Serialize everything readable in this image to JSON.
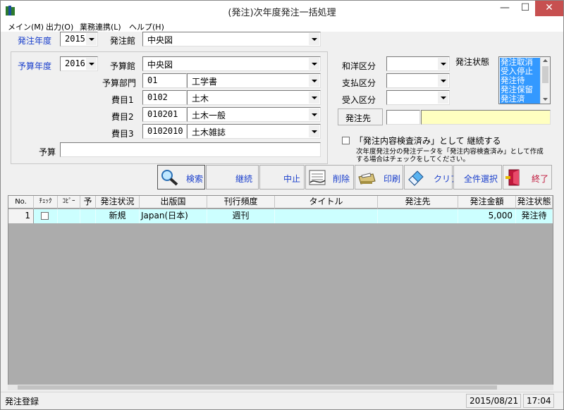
{
  "window": {
    "title": "(発注)次年度発注一括処理",
    "min": "—",
    "max": "☐",
    "close": "✕"
  },
  "menu": [
    "メイン(M)",
    "出力(O)",
    "業務連携(L)",
    "ヘルプ(H)"
  ],
  "top": {
    "order_year_label": "発注年度",
    "order_year": "2015",
    "order_lib_label": "発注館",
    "order_lib": "中央図"
  },
  "budget": {
    "year_label": "予算年度",
    "year": "2016",
    "lib_label": "予算館",
    "lib": "中央図",
    "dept_label": "予算部門",
    "dept_code": "01",
    "dept_name": "工学書",
    "item1_label": "費目1",
    "item1_code": "0102",
    "item1_name": "土木",
    "item2_label": "費目2",
    "item2_code": "010201",
    "item2_name": "土木一般",
    "item3_label": "費目3",
    "item3_code": "0102010",
    "item3_name": "土木雑誌",
    "budget_label": "予算",
    "budget_value": ""
  },
  "right": {
    "wayo_label": "和洋区分",
    "shiharai_label": "支払区分",
    "ukeire_label": "受入区分",
    "status_label": "発注状態",
    "status_options": [
      "発注取消",
      "受入停止",
      "発注待",
      "発注保留",
      "発注済"
    ],
    "vendor_button": "発注先",
    "continue_check": "「発注内容検査済み」として 継続する",
    "note_line1": "次年度発注分の発注データを「発注内容検査済み」として作成",
    "note_line2": "する場合はチェックをしてください。"
  },
  "toolbar": {
    "search": "検索",
    "continue": "継続",
    "stop": "中止",
    "delete": "削除",
    "print": "印刷",
    "clear": "クリア",
    "select_all": "全件選択",
    "exit": "終了"
  },
  "grid": {
    "headers": [
      "No.",
      "ﾁｪｯｸ",
      "ｺﾋﾟｰ",
      "予",
      "発注状況",
      "出版国",
      "刊行頻度",
      "タイトル",
      "発注先",
      "発注金額",
      "発注状態"
    ],
    "rows": [
      {
        "no": "1",
        "status": "新規",
        "country": "Japan(日本)",
        "freq": "週刊",
        "title": "",
        "vendor": "",
        "amount": "5,000",
        "order_state": "発注待"
      }
    ]
  },
  "status": {
    "message": "発注登録",
    "date": "2015/08/21",
    "time": "17:04"
  },
  "colors": {
    "label_blue": "#1a3fcc",
    "row_bg": "#ccffff",
    "vendor_bg": "#ffffc0",
    "close_red": "#c75050"
  }
}
